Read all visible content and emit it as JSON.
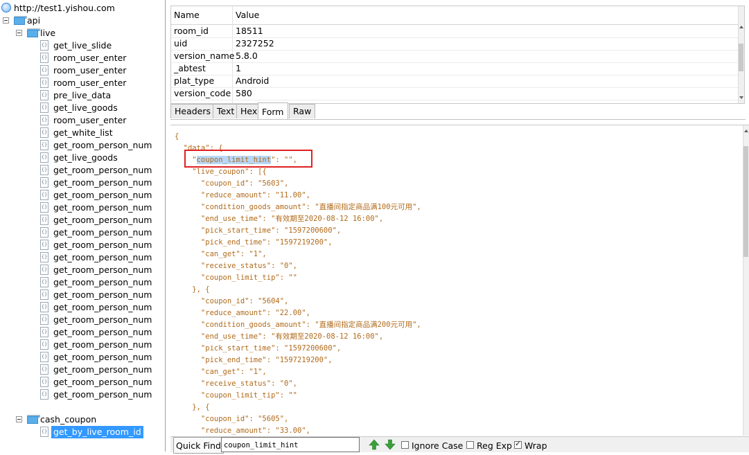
{
  "tree": {
    "root": "http://test1.yishou.com",
    "api": "api",
    "live": "live",
    "live_items": [
      "get_live_slide",
      "room_user_enter",
      "room_user_enter",
      "room_user_enter",
      "pre_live_data",
      "get_live_goods",
      "room_user_enter",
      "get_white_list",
      "get_room_person_num",
      "get_live_goods",
      "get_room_person_num",
      "get_room_person_num",
      "get_room_person_num",
      "get_room_person_num",
      "get_room_person_num",
      "get_room_person_num",
      "get_room_person_num",
      "get_room_person_num",
      "get_room_person_num",
      "get_room_person_num",
      "get_room_person_num",
      "get_room_person_num",
      "get_room_person_num",
      "get_room_person_num",
      "get_room_person_num",
      "get_room_person_num",
      "get_room_person_num",
      "get_room_person_num",
      "get_room_person_num"
    ],
    "cash_coupon": "cash_coupon",
    "selected_item": "get_by_live_room_id"
  },
  "grid": {
    "col_name": "Name",
    "col_value": "Value",
    "rows": [
      {
        "name": "room_id",
        "value": "18511"
      },
      {
        "name": "uid",
        "value": "2327252"
      },
      {
        "name": "version_name",
        "value": "5.8.0"
      },
      {
        "name": "_abtest",
        "value": "1"
      },
      {
        "name": "plat_type",
        "value": "Android"
      },
      {
        "name": "version_code",
        "value": "580"
      }
    ]
  },
  "tabs": [
    "Headers",
    "Text",
    "Hex",
    "Form",
    "Raw"
  ],
  "active_tab": "Form",
  "json_lines": [
    "{",
    "  \"data\": {",
    "    \"coupon_limit_hint\": \"\",",
    "    \"live_coupon\": [{",
    "      \"coupon_id\": \"5603\",",
    "      \"reduce_amount\": \"11.00\",",
    "      \"condition_goods_amount\": \"直播间指定商品满100元可用\",",
    "      \"end_use_time\": \"有效期至2020-08-12 16:00\",",
    "      \"pick_start_time\": \"1597200600\",",
    "      \"pick_end_time\": \"1597219200\",",
    "      \"can_get\": \"1\",",
    "      \"receive_status\": \"0\",",
    "      \"coupon_limit_tip\": \"\"",
    "    }, {",
    "      \"coupon_id\": \"5604\",",
    "      \"reduce_amount\": \"22.00\",",
    "      \"condition_goods_amount\": \"直播间指定商品满200元可用\",",
    "      \"end_use_time\": \"有效期至2020-08-12 16:00\",",
    "      \"pick_start_time\": \"1597200600\",",
    "      \"pick_end_time\": \"1597219200\",",
    "      \"can_get\": \"1\",",
    "      \"receive_status\": \"0\",",
    "      \"coupon_limit_tip\": \"\"",
    "    }, {",
    "      \"coupon_id\": \"5605\",",
    "      \"reduce_amount\": \"33.00\","
  ],
  "highlight_text": "coupon_limit_hint",
  "quickfind": {
    "label": "Quick Find",
    "value": "coupon_limit_hint",
    "ignore_case": "Ignore Case",
    "reg_exp": "Reg Exp",
    "wrap": "Wrap",
    "ignore_case_checked": false,
    "reg_exp_checked": false,
    "wrap_checked": true
  },
  "colors": {
    "accent": "#3399ff",
    "json_text": "#b06a1a",
    "highlight_box": "#e02020",
    "arrow_green": "#3aa13a"
  }
}
